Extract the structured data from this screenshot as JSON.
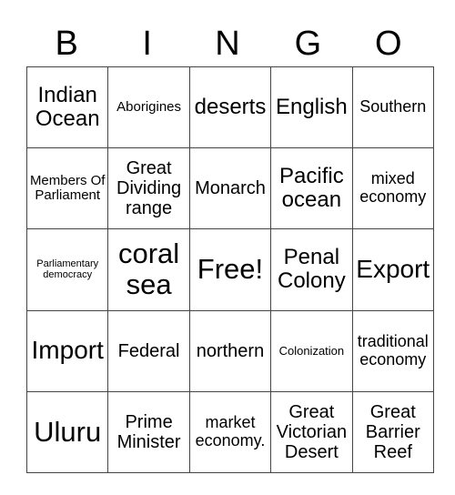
{
  "header": {
    "letters": [
      "B",
      "I",
      "N",
      "G",
      "O"
    ]
  },
  "board": {
    "rows": [
      [
        "Indian Ocean",
        "Aborigines",
        "deserts",
        "English",
        "Southern"
      ],
      [
        "Members Of Parliament",
        "Great Dividing range",
        "Monarch",
        "Pacific ocean",
        "mixed economy"
      ],
      [
        "Parliamentary democracy",
        "coral sea",
        "Free!",
        "Penal Colony",
        "Export"
      ],
      [
        "Import",
        "Federal",
        "northern",
        "Colonization",
        "traditional economy"
      ],
      [
        "Uluru",
        "Prime Minister",
        "market economy.",
        "Great Victorian Desert",
        "Great Barrier Reef"
      ]
    ]
  }
}
